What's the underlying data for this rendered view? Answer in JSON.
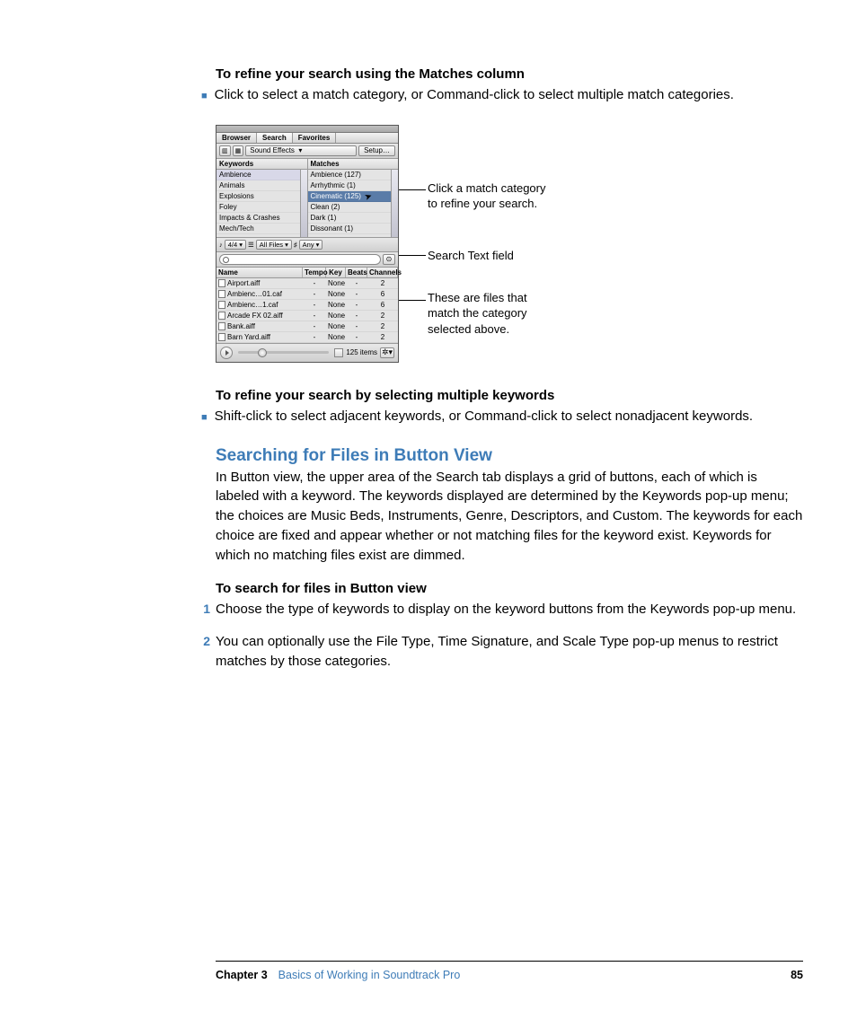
{
  "headings": {
    "h1": "To refine your search using the Matches column",
    "h2": "To refine your search by selecting multiple keywords",
    "h3": "Searching for Files in Button View",
    "h4": "To search for files in Button view"
  },
  "bullets": {
    "b1": "Click to select a match category, or Command-click to select multiple match categories.",
    "b2": "Shift-click to select adjacent keywords, or Command-click to select nonadjacent keywords."
  },
  "para1": "In Button view, the upper area of the Search tab displays a grid of buttons, each of which is labeled with a keyword. The keywords displayed are determined by the Keywords pop-up menu; the choices are Music Beds, Instruments, Genre, Descriptors, and Custom. The keywords for each choice are fixed and appear whether or not matching files for the keyword exist. Keywords for which no matching files exist are dimmed.",
  "steps": {
    "s1": "Choose the type of keywords to display on the keyword buttons from the Keywords pop-up menu.",
    "s2": "You can optionally use the File Type, Time Signature, and Scale Type pop-up menus to restrict matches by those categories."
  },
  "panel": {
    "tabs": [
      "Browser",
      "Search",
      "Favorites"
    ],
    "popup": "Sound Effects",
    "setup": "Setup…",
    "col1_head": "Keywords",
    "col2_head": "Matches",
    "keywords": [
      "Ambience",
      "Animals",
      "Explosions",
      "Foley",
      "Impacts & Crashes",
      "Mech/Tech"
    ],
    "matches": [
      "Ambience (127)",
      "Arrhythmic (1)",
      "Cinematic (125)",
      "Clean (2)",
      "Dark (1)",
      "Dissonant (1)"
    ],
    "filter": {
      "sig": "4/4",
      "files": "All Files",
      "any": "Any"
    },
    "table_heads": {
      "name": "Name",
      "tempo": "Tempo",
      "key": "Key",
      "beats": "Beats",
      "chan": "Channels"
    },
    "rows": [
      {
        "name": "Airport.aiff",
        "tempo": "-",
        "key": "None",
        "beats": "-",
        "chan": "2"
      },
      {
        "name": "Ambienc…01.caf",
        "tempo": "-",
        "key": "None",
        "beats": "-",
        "chan": "6"
      },
      {
        "name": "Ambienc…1.caf",
        "tempo": "-",
        "key": "None",
        "beats": "-",
        "chan": "6"
      },
      {
        "name": "Arcade FX 02.aiff",
        "tempo": "-",
        "key": "None",
        "beats": "-",
        "chan": "2"
      },
      {
        "name": "Bank.aiff",
        "tempo": "-",
        "key": "None",
        "beats": "-",
        "chan": "2"
      },
      {
        "name": "Barn Yard.aiff",
        "tempo": "-",
        "key": "None",
        "beats": "-",
        "chan": "2"
      }
    ],
    "items": "125 items"
  },
  "callouts": {
    "c1a": "Click a match category",
    "c1b": "to refine your search.",
    "c2": "Search Text field",
    "c3a": "These are files that",
    "c3b": "match the category",
    "c3c": "selected above."
  },
  "footer": {
    "chapter": "Chapter 3",
    "title": "Basics of Working in Soundtrack Pro",
    "page": "85"
  }
}
